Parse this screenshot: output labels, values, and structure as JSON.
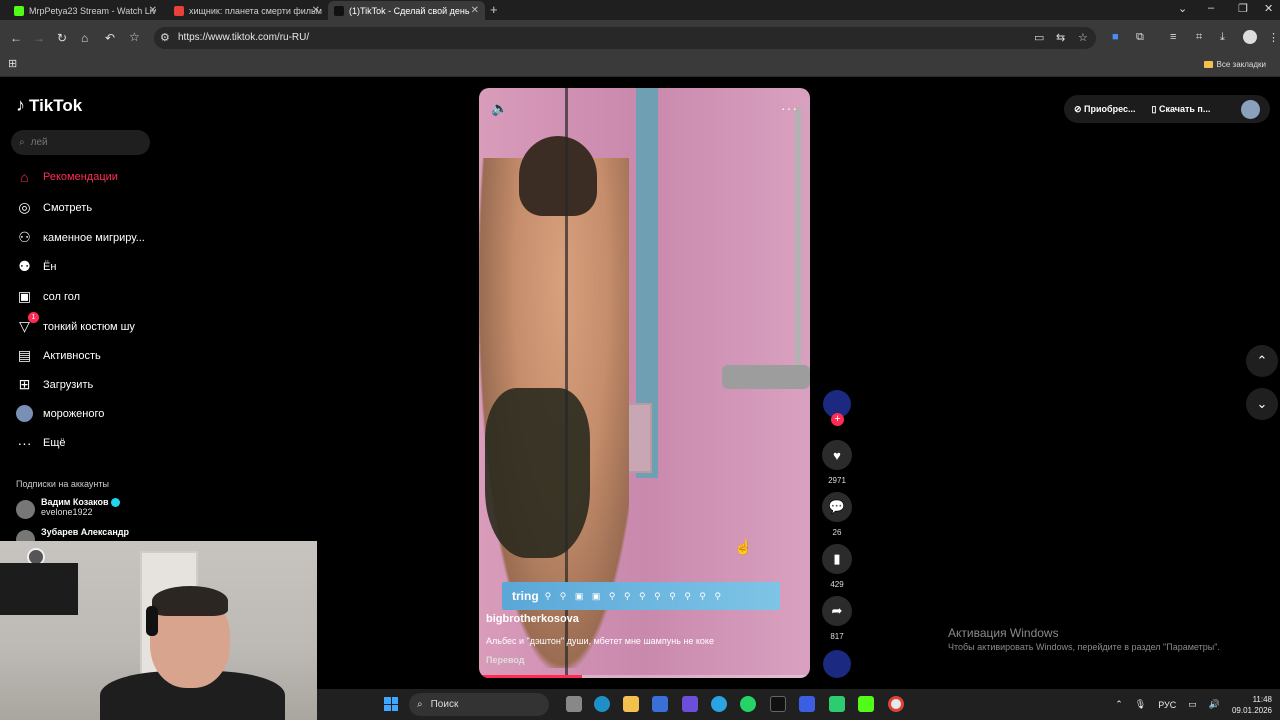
{
  "browser": {
    "tabs": [
      {
        "title": "MrpPetya23 Stream - Watch Liv",
        "favicon_color": "#53fc18",
        "active": false
      },
      {
        "title": "хищник: планета смерти фильм",
        "favicon_color": "#e8403a",
        "active": false
      },
      {
        "title": "(1)TikTok - Сделай свой день",
        "favicon_color": "#111111",
        "active": true
      }
    ],
    "new_tab": "+",
    "url": "https://www.tiktok.com/ru-RU/",
    "all_bookmarks": "Все закладки"
  },
  "tiktok": {
    "logo": "TikTok",
    "search_placeholder": "лей",
    "nav": [
      {
        "label": "Рекомендации",
        "icon": "home-icon",
        "active": true
      },
      {
        "label": "Смотреть",
        "icon": "compass-icon"
      },
      {
        "label": "каменное мигриру...",
        "icon": "person-follow-icon"
      },
      {
        "label": "Ён",
        "icon": "friends-icon"
      },
      {
        "label": "сол гол",
        "icon": "live-icon"
      },
      {
        "label": "тонкий костюм шу",
        "icon": "filter-icon",
        "badge": "1"
      },
      {
        "label": "Активность",
        "icon": "message-icon"
      },
      {
        "label": "Загрузить",
        "icon": "upload-icon"
      },
      {
        "label": "мороженого",
        "icon": "profile-icon"
      },
      {
        "label": "Ещё",
        "icon": "more-icon"
      }
    ],
    "subscriptions_title": "Подписки на аккаунты",
    "subscriptions": [
      {
        "name": "Вадим Козаков",
        "handle": "evelone1922",
        "verified": true
      },
      {
        "name": "Зубарев Александр",
        "handle": ""
      }
    ],
    "top_right": {
      "get_coins": "Приобрес...",
      "download_app": "Скачать п..."
    },
    "video": {
      "author": "bigbrotherkosova",
      "caption": "Альбес и \"дэштон\" души, мбетет мне шампунь не коке",
      "translate": "Перевод",
      "banner_brand": "tring",
      "progress": 0.31
    },
    "actions": {
      "likes": "2971",
      "comments": "26",
      "saves": "429",
      "shares": "817"
    }
  },
  "windows": {
    "activation_title": "Активация Windows",
    "activation_text": "Чтобы активировать Windows, перейдите в раздел \"Параметры\".",
    "search": "Поиск",
    "lang": "РУС",
    "time": "11:48",
    "date": "09.01.2026"
  }
}
